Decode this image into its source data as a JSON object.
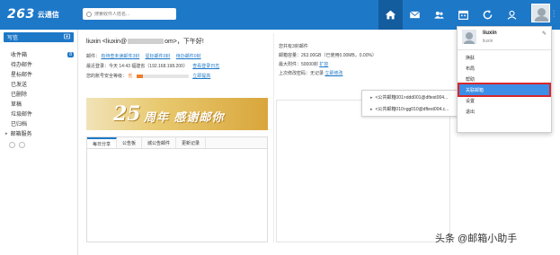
{
  "header": {
    "logo_text": "263",
    "logo_sub": "云通信",
    "search_placeholder": "搜索收件人姓名...",
    "icons": [
      "home-icon",
      "mail-icon",
      "contacts-icon",
      "calendar-icon",
      "sync-icon",
      "user-badge-icon"
    ],
    "accent": "#1e78c8"
  },
  "sidebar": {
    "write_label": "写信",
    "items": [
      {
        "label": "收件箱",
        "badge": "8"
      },
      {
        "label": "待办邮件",
        "badge": ""
      },
      {
        "label": "星标邮件",
        "badge": ""
      },
      {
        "label": "已发送",
        "badge": ""
      },
      {
        "label": "已删除",
        "badge": ""
      },
      {
        "label": "草稿",
        "badge": ""
      },
      {
        "label": "垃圾邮件",
        "badge": ""
      },
      {
        "label": "已归档",
        "badge": ""
      }
    ],
    "group_label": "邮箱服务"
  },
  "main": {
    "greeting_name": "liuxin",
    "greeting_email_prefix": "<liuxin@",
    "greeting_email_suffix": "om>，下午好!",
    "mail_row_label": "邮件：",
    "mail_links": [
      "有待查未读邮件3封",
      "星标邮件0封",
      "待办邮件0封"
    ],
    "last_login": "最近登录：今天 14:43 福建省（192.168.198.200）",
    "login_log_link": "查看登录日志",
    "security_label": "您的账号安全等级：",
    "security_level": "低",
    "security_level_value": 0.12,
    "security_link": "立即提高",
    "banner_num": "25",
    "banner_text": "周年 感谢邮你",
    "tabs": [
      "每日分享",
      "公告板",
      "城公告邮件",
      "更新记录"
    ]
  },
  "right": {
    "lines": [
      "您共有3封邮件",
      "邮箱容量：263.00GB（已使用0.00MB，0.00%）",
      "最大附件：50000封",
      "上次修改密码：无记录"
    ],
    "attach_link": "扩容",
    "pwd_link": "立即修改"
  },
  "shared_popup": {
    "items": [
      "<公共邮箱001>ddd001@dftest004...",
      "<公共邮箱010>gg010@dftest004.c..."
    ]
  },
  "user_menu": {
    "name": "liuxin",
    "sub": "liuxin",
    "items": [
      "换肤",
      "布局",
      "帮助",
      "关联邮箱",
      "设置",
      "退出"
    ],
    "highlight_color": "#3d8ee6"
  },
  "watermark": "头条 @邮箱小助手"
}
